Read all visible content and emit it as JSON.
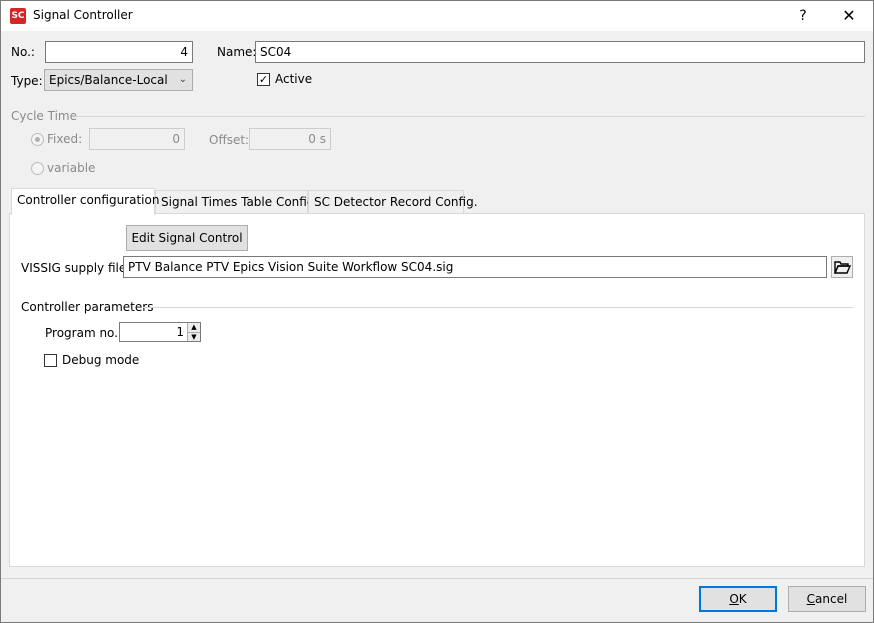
{
  "window": {
    "title": "Signal Controller",
    "app_icon_text": "SC",
    "help_label": "?",
    "close_label": "✕"
  },
  "form": {
    "no_label": "No.:",
    "no_value": "4",
    "name_label": "Name:",
    "name_value": "SC04",
    "type_label": "Type:",
    "type_value": "Epics/Balance-Local",
    "active_label": "Active",
    "active_checked": true
  },
  "cycle_time": {
    "group_label": "Cycle Time",
    "fixed_label": "Fixed:",
    "fixed_value": "0",
    "fixed_selected": true,
    "offset_label": "Offset:",
    "offset_value": "0 s",
    "variable_label": "variable"
  },
  "tabs": [
    {
      "label": "Controller configuration",
      "active": true
    },
    {
      "label": "Signal Times Table Config.",
      "active": false
    },
    {
      "label": "SC Detector Record Config.",
      "active": false
    }
  ],
  "controller_config": {
    "edit_button_label": "Edit Signal Control",
    "supply_file_label": "VISSIG supply file:",
    "supply_file_value": "PTV Balance PTV Epics Vision Suite Workflow SC04.sig",
    "params_group_label": "Controller parameters",
    "program_no_label": "Program no.:",
    "program_no_value": "1",
    "debug_mode_label": "Debug mode",
    "debug_mode_checked": false
  },
  "footer": {
    "ok_label_accel": "O",
    "ok_label_rest": "K",
    "cancel_label_accel": "C",
    "cancel_label_rest": "ancel"
  },
  "icons": {
    "chevron": "chevron-down-icon",
    "folder": "folder-open-icon",
    "check": "check-icon"
  },
  "colors": {
    "accent": "#0078d7",
    "app_icon": "#d32626",
    "disabled_text": "#8a8a8a"
  }
}
